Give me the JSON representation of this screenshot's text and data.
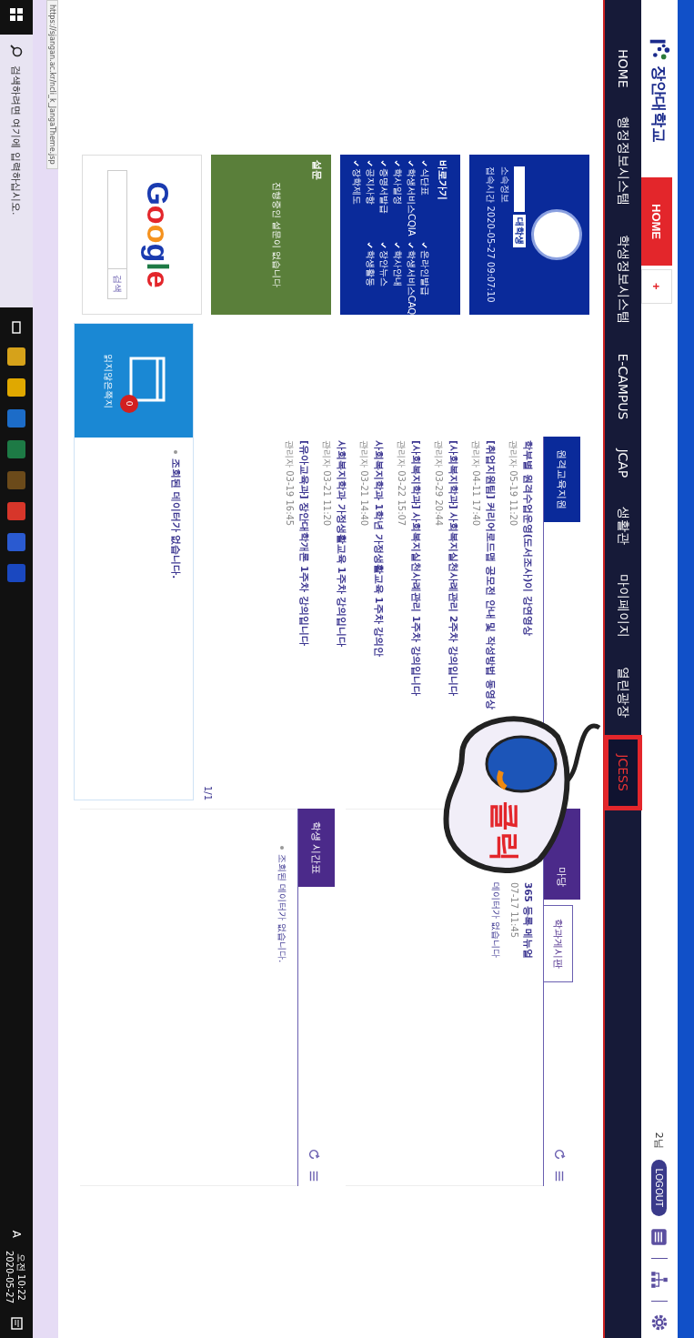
{
  "header": {
    "logo": "장안대학교",
    "tabs": [
      {
        "label": "HOME",
        "selected": true
      },
      {
        "label": "+",
        "selected": false
      }
    ],
    "user": "2님",
    "logout": "LOGOUT"
  },
  "nav": {
    "items": [
      {
        "label": "HOME",
        "highlighted": false
      },
      {
        "label": "행정정보시스템",
        "highlighted": false
      },
      {
        "label": "학생정보시스템",
        "highlighted": false
      },
      {
        "label": "E-CAMPUS",
        "highlighted": false
      },
      {
        "label": "JCAP",
        "highlighted": false
      },
      {
        "label": "생활관",
        "highlighted": false
      },
      {
        "label": "마이페이지",
        "highlighted": false
      },
      {
        "label": "열린광장",
        "highlighted": false
      },
      {
        "label": "JCESS",
        "highlighted": true
      }
    ]
  },
  "profile": {
    "name": "대학생",
    "lines": [
      "소속정보",
      "접속시간 2020-05-27 09:07:10"
    ]
  },
  "quick_links": {
    "title": "바로가기",
    "items": [
      "식단표",
      "온라인발급",
      "학생서비스CQIA",
      "학생서비스CAQ",
      "학사일정",
      "학사안내",
      "증명서발급",
      "장안뉴스",
      "공지사항",
      "학생활동",
      "장학제도"
    ]
  },
  "survey": {
    "title": "설문",
    "message": "진행중인 설문이 없습니다"
  },
  "google": {
    "logo": "Google",
    "button": "검색"
  },
  "notices": {
    "tab": "원격교육지원",
    "pager": "1/1",
    "posts": [
      {
        "title": "학부별 원격수업운영(도서조사)이 강연영상",
        "meta": "관리자 05-19 11:20"
      },
      {
        "title": "[취업지원팀] 커리어로드맵 공모전 안내 및 작성방법 동영상",
        "meta": "관리자 04-11 17:40"
      },
      {
        "title": "[사회복지학과] 사회복지실천사례관리 2주차 강의입니다",
        "meta": "관리자 03-29 20:44"
      },
      {
        "title": "[사회복지학과] 사회복지실천사례관리 1주차 강의입니다",
        "meta": "관리자 03-22 15:07"
      },
      {
        "title": "사회복지학과 1학년 가정생활교육 1주차 강의안",
        "meta": "관리자 03-21 14:40"
      },
      {
        "title": "사회복지학과 가정생활교육 1주차 강의입니다",
        "meta": "관리자 03-21 11:20"
      },
      {
        "title": "[유아교육과] 장안대학개론 1주차 강의입니다",
        "meta": "관리자 03-19 16:45"
      }
    ]
  },
  "notes_card": {
    "label": "읽지않은쪽지",
    "count": "0",
    "empty": "조회된 데이터가 없습니다."
  },
  "board": {
    "tabs": [
      {
        "label": "마당",
        "selected": true
      },
      {
        "label": "학과게시판",
        "selected": false
      }
    ],
    "posts": [
      {
        "title": "365 등록 메뉴얼",
        "meta": "07-17 11:45"
      }
    ],
    "empty": "데이터가 없습니다"
  },
  "timetable": {
    "tab": "학생 시간표",
    "empty": "조회된 데이터가 없습니다."
  },
  "callout": {
    "text": "클릭"
  },
  "status_url": "https://sjangan.ac.kr/ncli_k_JangaTheme.jsp",
  "taskbar": {
    "search_placeholder": "검색하려면 여기에 입력하십시오.",
    "ime": "A",
    "time": "오전 10:22",
    "date": "2020-05-27"
  }
}
